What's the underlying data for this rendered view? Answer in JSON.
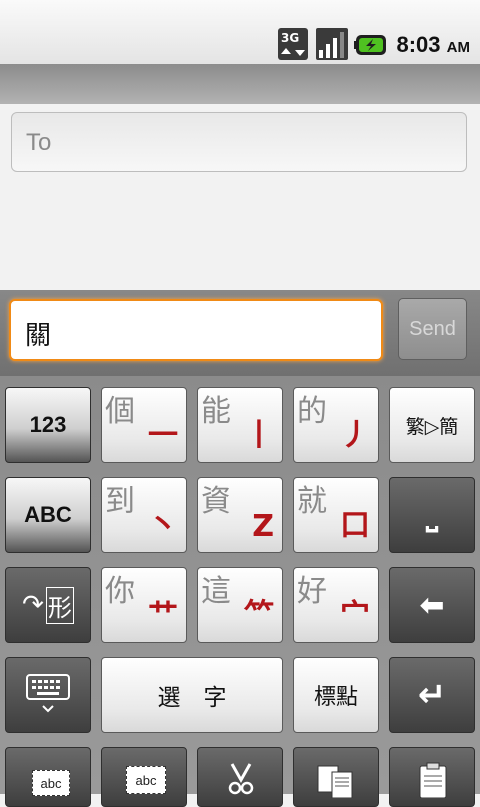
{
  "status_bar": {
    "network": "3G",
    "time": "8:03",
    "ampm": "AM"
  },
  "recipient": {
    "placeholder": "To"
  },
  "compose": {
    "message_text": "關",
    "send_label": "Send"
  },
  "keyboard": {
    "row1": {
      "mode_123": "123",
      "k1": {
        "char": "個",
        "stroke": "一"
      },
      "k2": {
        "char": "能",
        "stroke": "丨"
      },
      "k3": {
        "char": "的",
        "stroke": "丿"
      },
      "convert_label": "繁▷簡"
    },
    "row2": {
      "mode_abc": "ABC",
      "k1": {
        "char": "到",
        "stroke": "丶"
      },
      "k2": {
        "char": "資",
        "stroke": "Z"
      },
      "k3": {
        "char": "就",
        "stroke": "口"
      },
      "space_glyph": "⎵"
    },
    "row3": {
      "shape_label": "形",
      "k1": {
        "char": "你",
        "stroke": "艹"
      },
      "k2": {
        "char": "這",
        "stroke": "⺮"
      },
      "k3": {
        "char": "好",
        "stroke": "宀"
      },
      "delete_glyph": "⬅"
    },
    "row4": {
      "select_char_label": "選　字",
      "punctuation_label": "標點",
      "enter_glyph": "↵"
    },
    "row5": {
      "select_abc": "abc",
      "cursor_abc": "abc"
    }
  }
}
